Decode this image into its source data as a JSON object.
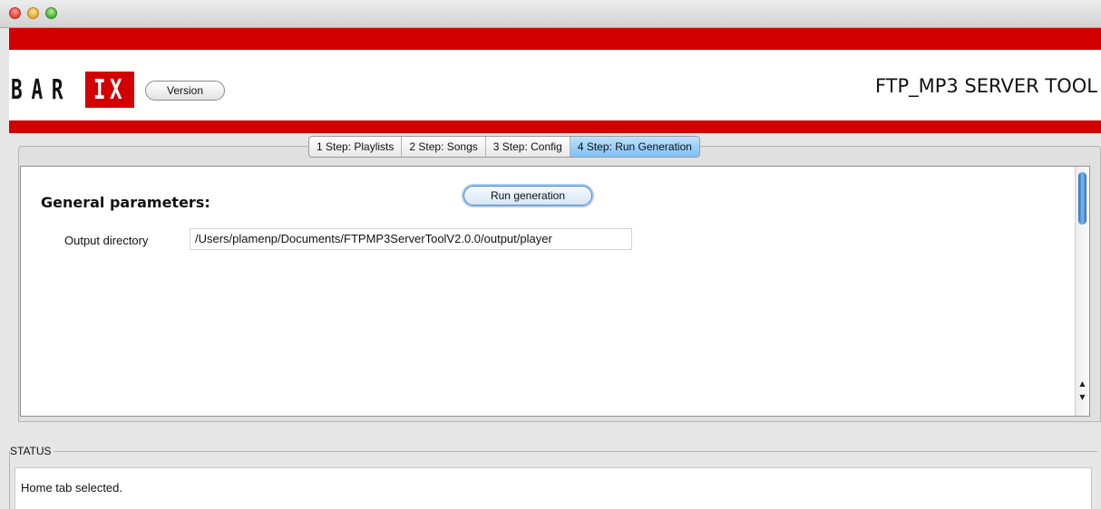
{
  "window": {
    "controls": [
      "close",
      "minimize",
      "maximize"
    ]
  },
  "header": {
    "logo": {
      "letters": "BAR",
      "box_letters": "IX",
      "colors": {
        "brand_red": "#d20000",
        "text": "#111111"
      }
    },
    "version_label": "Version",
    "title": "FTP_MP3 SERVER TOOL"
  },
  "tabs": [
    {
      "label": "1 Step: Playlists",
      "active": false
    },
    {
      "label": "2 Step: Songs",
      "active": false
    },
    {
      "label": "3 Step: Config",
      "active": false
    },
    {
      "label": "4 Step: Run Generation",
      "active": true
    }
  ],
  "main": {
    "section_title": "General parameters:",
    "run_button_label": "Run generation",
    "output_directory": {
      "label": "Output directory",
      "value": "/Users/plamenp/Documents/FTPMP3ServerToolV2.0.0/output/player"
    },
    "scrollbar": {
      "up_icon": "triangle-up",
      "down_icon": "triangle-down"
    }
  },
  "status": {
    "label": "STATUS",
    "message": "Home tab selected."
  },
  "colors": {
    "tab_active": "#7fc0f5",
    "scroll_thumb": "#2a6fc2"
  }
}
